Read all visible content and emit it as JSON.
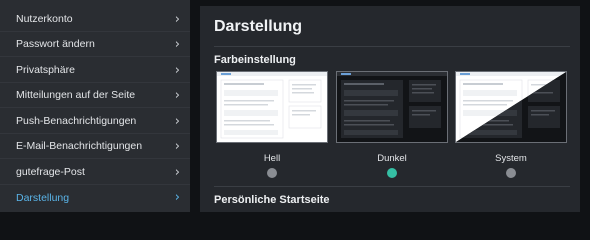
{
  "sidebar": {
    "items": [
      {
        "label": "Nutzerkonto",
        "active": false
      },
      {
        "label": "Passwort ändern",
        "active": false
      },
      {
        "label": "Privatsphäre",
        "active": false
      },
      {
        "label": "Mitteilungen auf der Seite",
        "active": false
      },
      {
        "label": "Push-Benachrichtigungen",
        "active": false
      },
      {
        "label": "E-Mail-Benachrichtigungen",
        "active": false
      },
      {
        "label": "gutefrage-Post",
        "active": false
      },
      {
        "label": "Darstellung",
        "active": true
      }
    ],
    "chevron": "›"
  },
  "main": {
    "title": "Darstellung",
    "color_section": "Farbeinstellung",
    "themes": [
      {
        "label": "Hell",
        "selected": false
      },
      {
        "label": "Dunkel",
        "selected": true
      },
      {
        "label": "System",
        "selected": false
      }
    ],
    "start_section": "Persönliche Startseite"
  },
  "colors": {
    "accent_active": "#5ab4e8",
    "radio_selected": "#35bfa4"
  }
}
